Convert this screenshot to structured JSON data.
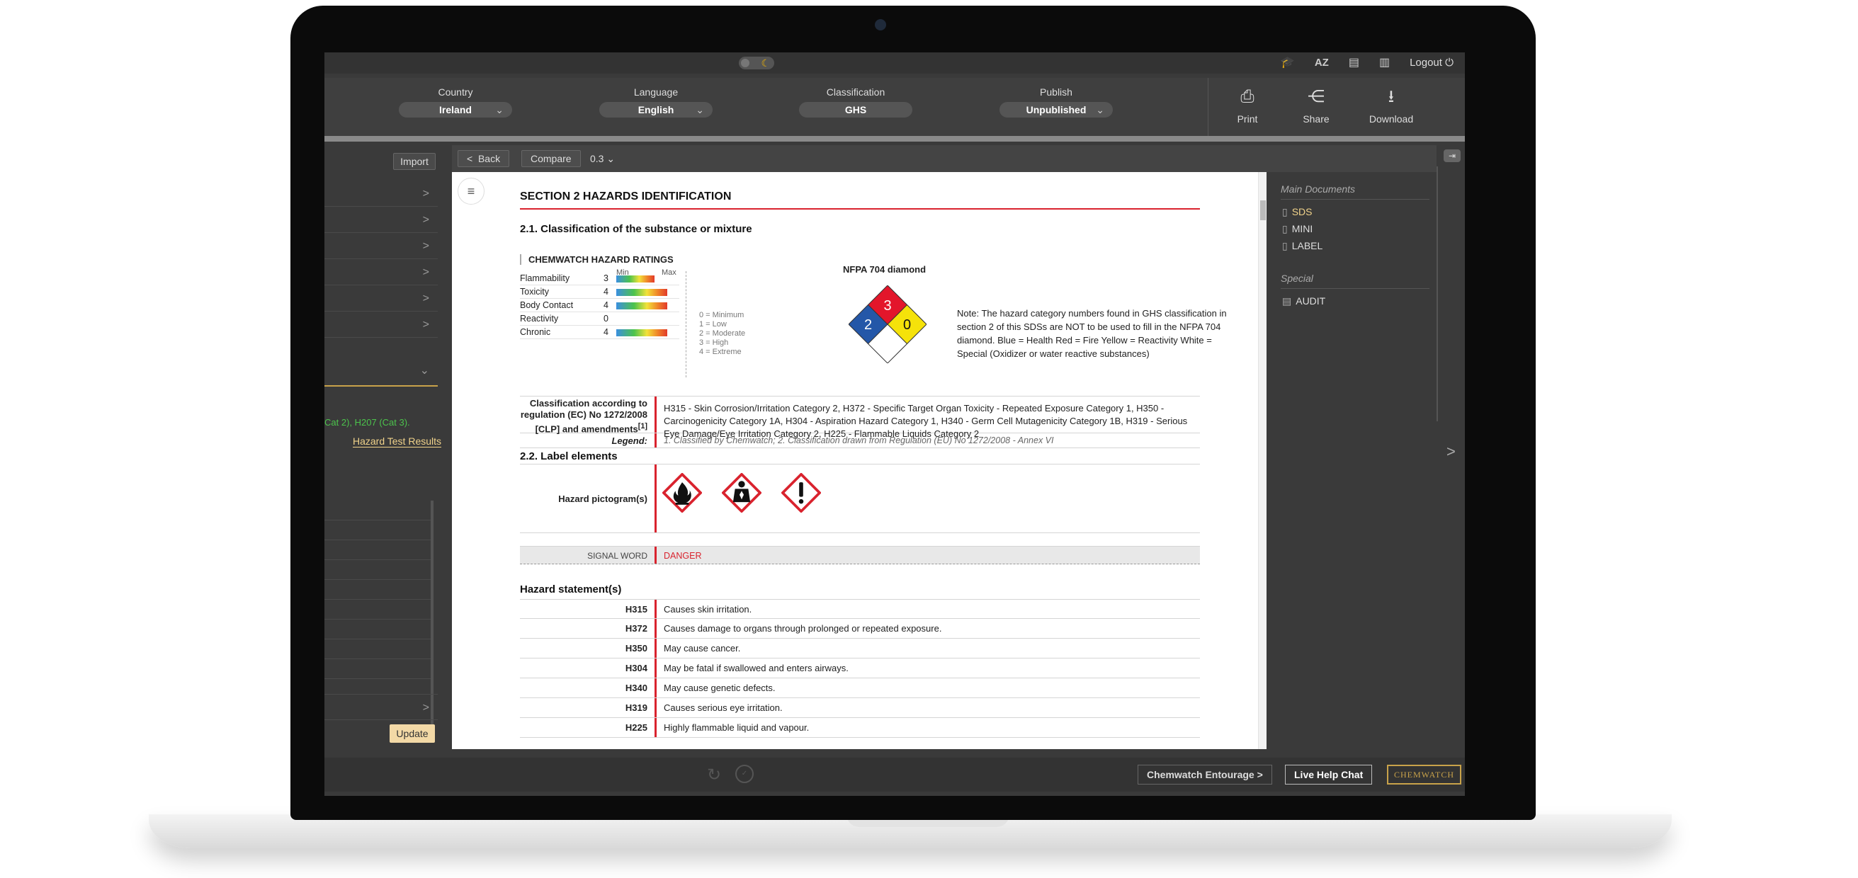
{
  "topbar": {
    "icons": [
      "graduation-cap-icon",
      "az-icon",
      "clipboard-icon",
      "book-icon"
    ],
    "az_label": "AZ",
    "logout_label": "Logout"
  },
  "selectors": {
    "country": {
      "label": "Country",
      "value": "Ireland"
    },
    "language": {
      "label": "Language",
      "value": "English"
    },
    "classification": {
      "label": "Classification",
      "value": "GHS"
    },
    "publish": {
      "label": "Publish",
      "value": "Unpublished"
    }
  },
  "actions": {
    "print": "Print",
    "share": "Share",
    "download": "Download"
  },
  "left_panel": {
    "import_label": "Import",
    "truncated_text": "Cat 2),  H207 (Cat 3).",
    "hazard_test_results": "Hazard Test Results",
    "update_label": "Update"
  },
  "doc_toolbar": {
    "back_label": "Back",
    "compare_label": "Compare",
    "version": "0.3"
  },
  "document": {
    "section_title": "SECTION 2 HAZARDS IDENTIFICATION",
    "sub_21": "2.1. Classification of the substance or mixture",
    "ratings_title": "CHEMWATCH HAZARD RATINGS",
    "min_label": "Min",
    "max_label": "Max",
    "ratings": [
      {
        "name": "Flammability",
        "value": 3
      },
      {
        "name": "Toxicity",
        "value": 4
      },
      {
        "name": "Body Contact",
        "value": 4
      },
      {
        "name": "Reactivity",
        "value": 0
      },
      {
        "name": "Chronic",
        "value": 4
      }
    ],
    "scale_legend": [
      "0 = Minimum",
      "1 = Low",
      "2 = Moderate",
      "3 = High",
      "4 = Extreme"
    ],
    "nfpa_title": "NFPA 704 diamond",
    "nfpa": {
      "fire": "3",
      "health": "2",
      "reactivity": "0",
      "special": "",
      "colors": {
        "fire": "#e3162b",
        "health": "#2457a8",
        "reactivity": "#f5e20a",
        "special": "#ffffff"
      }
    },
    "note": "Note: The hazard category numbers found in GHS classification in section 2 of this SDSs are NOT to be used to fill in the NFPA 704 diamond. Blue = Health Red = Fire Yellow = Reactivity White = Special (Oxidizer or water reactive substances)",
    "classification_label": "Classification according to regulation (EC) No 1272/2008 [CLP] and amendments",
    "classification_sup": "[1]",
    "classification_text": "H315 - Skin Corrosion/Irritation Category 2, H372 - Specific Target Organ Toxicity - Repeated Exposure Category 1, H350 - Carcinogenicity Category 1A, H304 - Aspiration Hazard Category 1, H340 - Germ Cell Mutagenicity Category 1B, H319 - Serious Eye Damage/Eye Irritation Category 2, H225 - Flammable Liquids Category 2",
    "legend_label": "Legend:",
    "legend_text": "1. Classified by Chemwatch; 2. Classification drawn from Regulation (EU) No 1272/2008 - Annex VI",
    "sub_22": "2.2. Label elements",
    "pictogram_label": "Hazard pictogram(s)",
    "pictograms": [
      "flame-pictogram-icon",
      "health-hazard-pictogram-icon",
      "exclamation-pictogram-icon"
    ],
    "signal_word_label": "SIGNAL WORD",
    "signal_word": "DANGER",
    "hazard_statements_title": "Hazard statement(s)",
    "hazard_statements": [
      {
        "code": "H315",
        "text": "Causes skin irritation."
      },
      {
        "code": "H372",
        "text": "Causes damage to organs through prolonged or repeated exposure."
      },
      {
        "code": "H350",
        "text": "May cause cancer."
      },
      {
        "code": "H304",
        "text": "May be fatal if swallowed and enters airways."
      },
      {
        "code": "H340",
        "text": "May cause genetic defects."
      },
      {
        "code": "H319",
        "text": "Causes serious eye irritation."
      },
      {
        "code": "H225",
        "text": "Highly flammable liquid and vapour."
      }
    ]
  },
  "right_panel": {
    "main_documents_title": "Main Documents",
    "main_documents": [
      "SDS",
      "MINI",
      "LABEL"
    ],
    "special_title": "Special",
    "special_items": [
      "AUDIT"
    ]
  },
  "bottombar": {
    "entourage_label": "Chemwatch Entourage",
    "live_help_label": "Live Help Chat",
    "brand_label": "CHEMWATCH"
  },
  "colors": {
    "accent_red": "#d9232e",
    "gold": "#c8a24a",
    "sds_active": "#f0d28a"
  }
}
